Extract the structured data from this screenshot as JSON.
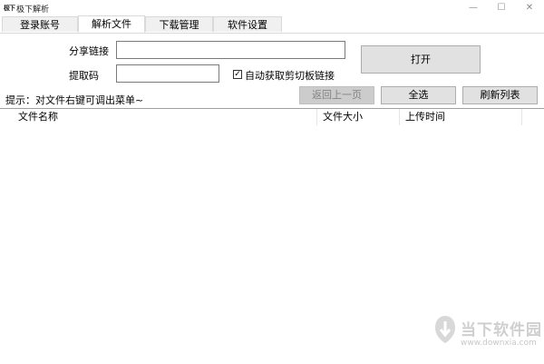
{
  "window": {
    "title": "极下解析",
    "app_icon": "极下",
    "minimize": "—",
    "maximize": "☐",
    "close": "✕"
  },
  "tabs": [
    {
      "label": "登录账号"
    },
    {
      "label": "解析文件",
      "active": true
    },
    {
      "label": "下载管理"
    },
    {
      "label": "软件设置"
    }
  ],
  "form": {
    "share_link_label": "分享链接",
    "share_link_value": "",
    "extract_code_label": "提取码",
    "extract_code_value": "",
    "auto_clipboard_label": "自动获取剪切板链接",
    "auto_clipboard_checked": true,
    "checkbox_mark": "✓",
    "open_button": "打开"
  },
  "hint": "提示：对文件右键可调出菜单~",
  "actions": {
    "back_button": "返回上一页",
    "back_disabled": true,
    "select_all_button": "全选",
    "refresh_button": "刷新列表"
  },
  "file_list": {
    "columns": [
      "文件名称",
      "文件大小",
      "上传时间"
    ],
    "rows": []
  },
  "watermark": {
    "name": "当下软件园",
    "url": "www.downxia.com"
  },
  "colors": {
    "button_face": "#e1e1e1",
    "button_border": "#adadad",
    "disabled_face": "#cccccc",
    "disabled_text": "#838383",
    "tab_inactive": "#f0f0f0"
  }
}
